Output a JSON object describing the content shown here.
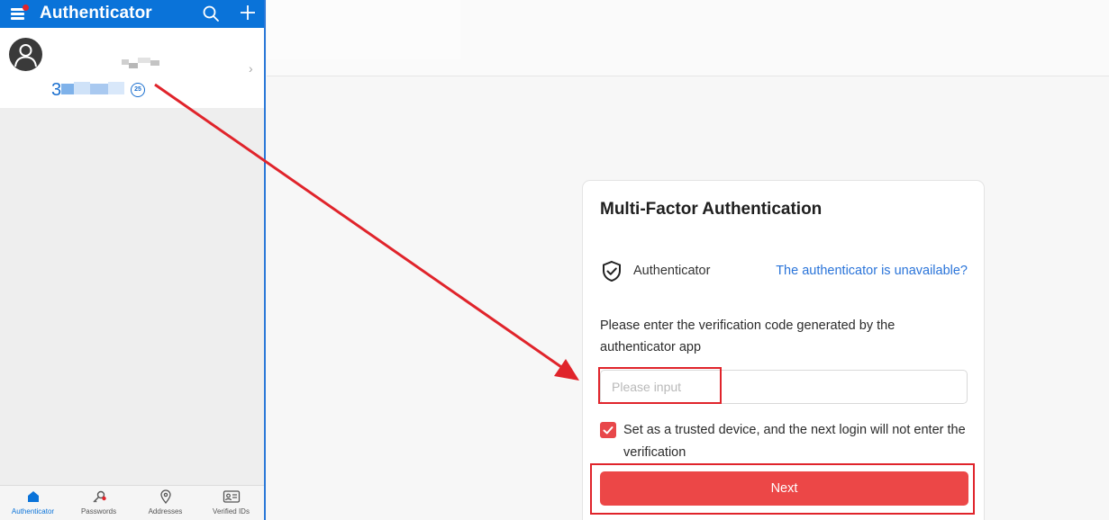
{
  "app": {
    "title": "Authenticator",
    "account": {
      "code_visible_prefix": "3",
      "timer": "25"
    },
    "nav": [
      {
        "label": "Authenticator",
        "icon": "home-icon",
        "active": true
      },
      {
        "label": "Passwords",
        "icon": "key-icon",
        "active": false
      },
      {
        "label": "Addresses",
        "icon": "location-pin-icon",
        "active": false
      },
      {
        "label": "Verified IDs",
        "icon": "id-card-icon",
        "active": false
      }
    ]
  },
  "mfa": {
    "title": "Multi-Factor Authentication",
    "method_label": "Authenticator",
    "unavailable_link": "The authenticator is unavailable?",
    "instruction": "Please enter the verification code generated by the authenticator app",
    "input_placeholder": "Please input",
    "trusted_device_text": "Set as a trusted device, and the next login will not enter the verification",
    "trusted_device_checked": true,
    "next_label": "Next"
  },
  "colors": {
    "app_blue": "#0a73d9",
    "accent_red": "#ec4747",
    "link_blue": "#2a74d9",
    "annotation_red": "#e0242b"
  }
}
